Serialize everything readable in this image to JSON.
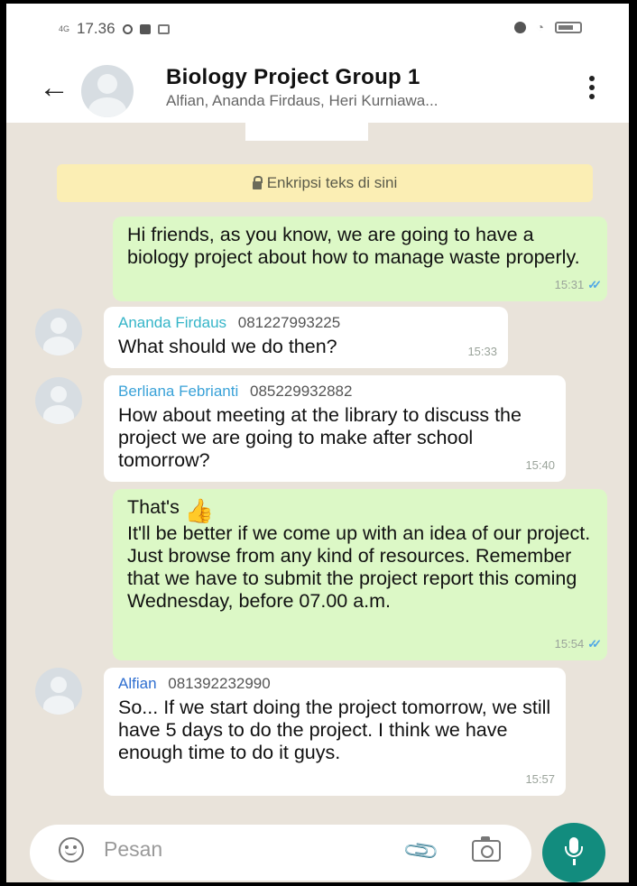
{
  "status_bar": {
    "signal": "4G",
    "time": "17.36"
  },
  "header": {
    "title": "Biology Project Group 1",
    "subtitle": "Alfian, Ananda Firdaus, Heri Kurniawa..."
  },
  "encryption_notice": "Enkripsi teks di sini",
  "messages": [
    {
      "direction": "out",
      "text": "Hi friends, as you know, we are going to have a biology project about how to manage waste properly.",
      "time": "15:31"
    },
    {
      "direction": "in",
      "sender": "Ananda Firdaus",
      "phone": "081227993225",
      "sender_color": "#35b5c8",
      "text": "What should we do then?",
      "time": "15:33"
    },
    {
      "direction": "in",
      "sender": "Berliana Febrianti",
      "phone": "085229932882",
      "sender_color": "#3aa2d8",
      "text": "How about meeting  at the library to discuss the project we are going to make after school tomorrow?",
      "time": "15:40"
    },
    {
      "direction": "out",
      "text_first": "That's",
      "emoji": "👍",
      "text": "It'll be better if we come up with an idea of our project. Just browse from any kind of resources. Remember that we have to submit the project report this coming Wednesday, before 07.00 a.m.",
      "time": "15:54"
    },
    {
      "direction": "in",
      "sender": "Alfian",
      "phone": "081392232990",
      "sender_color": "#2f6fd0",
      "text": "So... If we start doing the project tomorrow, we still have 5 days to do the project. I think we have enough time to do it guys.",
      "time": "15:57"
    }
  ],
  "input": {
    "placeholder": "Pesan"
  },
  "colors": {
    "outgoing": "#dcf8c6",
    "incoming": "#ffffff",
    "accent": "#128c7e",
    "read_ticks": "#4fa7e6"
  }
}
